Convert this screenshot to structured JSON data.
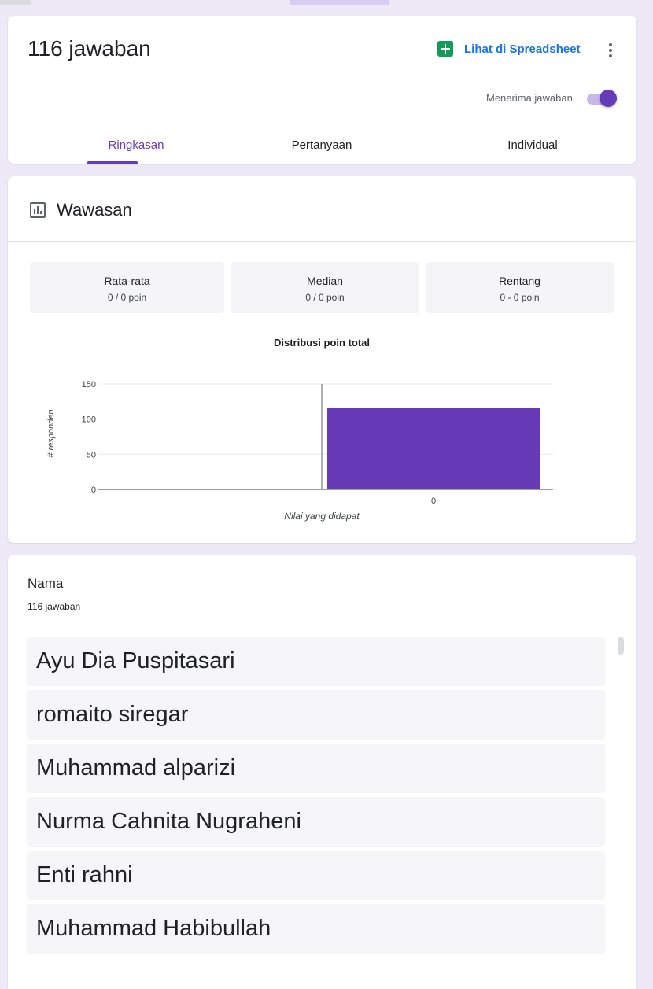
{
  "header": {
    "response_count": "116 jawaban",
    "spreadsheet_link": "Lihat di Spreadsheet",
    "accepting_label": "Menerima jawaban",
    "accepting": true,
    "tabs": [
      {
        "label": "Ringkasan",
        "active": true
      },
      {
        "label": "Pertanyaan",
        "active": false
      },
      {
        "label": "Individual",
        "active": false
      }
    ]
  },
  "insights": {
    "title": "Wawasan",
    "stats": [
      {
        "label": "Rata-rata",
        "value": "0 / 0 poin"
      },
      {
        "label": "Median",
        "value": "0 / 0 poin"
      },
      {
        "label": "Rentang",
        "value": "0 - 0 poin"
      }
    ]
  },
  "chart_data": {
    "type": "bar",
    "title": "Distribusi poin total",
    "xlabel": "Nilai yang didapat",
    "ylabel": "# responden",
    "categories": [
      "0"
    ],
    "values": [
      116
    ],
    "ylim": [
      0,
      150
    ],
    "yticks": [
      "0",
      "50",
      "100",
      "150"
    ],
    "grid": true,
    "bar_color": "#673ab7"
  },
  "question": {
    "title": "Nama",
    "count": "116 jawaban",
    "answers": [
      "Ayu Dia Puspitasari",
      "romaito siregar",
      "Muhammad alparizi",
      "Nurma Cahnita Nugraheni",
      "Enti rahni",
      "Muhammad Habibullah"
    ]
  },
  "colors": {
    "accent": "#673ab7",
    "link": "#1a73e8",
    "sheets_green": "#0f9d58",
    "background": "#ede9f6"
  }
}
